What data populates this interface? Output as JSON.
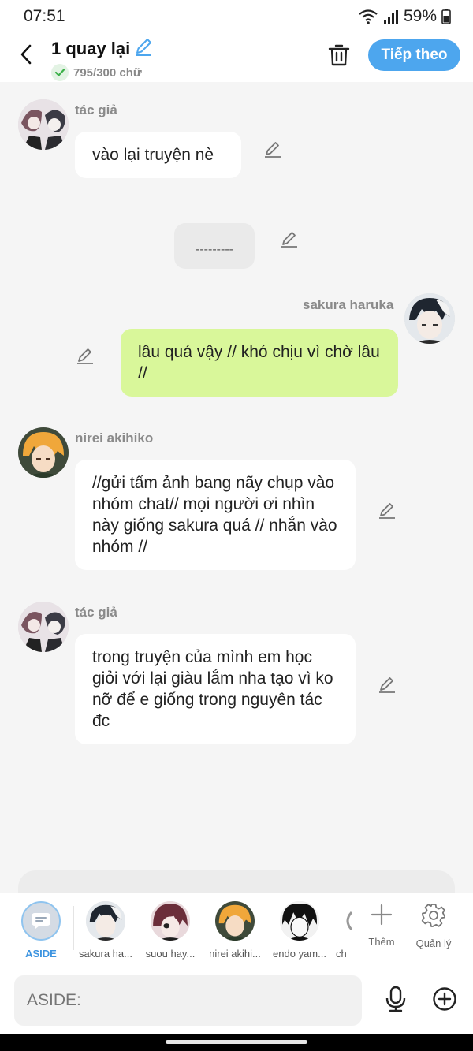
{
  "status_bar": {
    "time": "07:51",
    "battery": "59%"
  },
  "header": {
    "title": "1 quay lại",
    "word_count": "795/300 chữ",
    "next_label": "Tiếp theo"
  },
  "messages": [
    {
      "name": "tác giả",
      "text": "vào lại truyện nè"
    },
    {
      "text": "---------"
    },
    {
      "name": "sakura haruka",
      "text": "lâu quá vậy // khó chịu vì chờ lâu //"
    },
    {
      "name": "nirei akihiko",
      "text": "//gửi tấm ảnh bang nãy chụp vào nhóm chat// mọi người ơi nhìn này giống sakura quá // nhắn vào nhóm //"
    },
    {
      "name": "tác giả",
      "text": "trong truyện của mình em học giỏi với lại giàu lắm nha tạo vì ko nỡ để e giống trong nguyên tác đc"
    }
  ],
  "characters": [
    {
      "label": "ASIDE",
      "icon": "chat-bubble-icon"
    },
    {
      "label": "sakura ha..."
    },
    {
      "label": "suou hay..."
    },
    {
      "label": "nirei akihi..."
    },
    {
      "label": "endo yam..."
    },
    {
      "label": "ch"
    }
  ],
  "tools": {
    "add_label": "Thêm",
    "manage_label": "Quản lý"
  },
  "composer": {
    "placeholder": "ASIDE:"
  },
  "colors": {
    "accent": "#4da6ee",
    "user_bubble": "#d9f79a",
    "background": "#f5f5f5"
  }
}
